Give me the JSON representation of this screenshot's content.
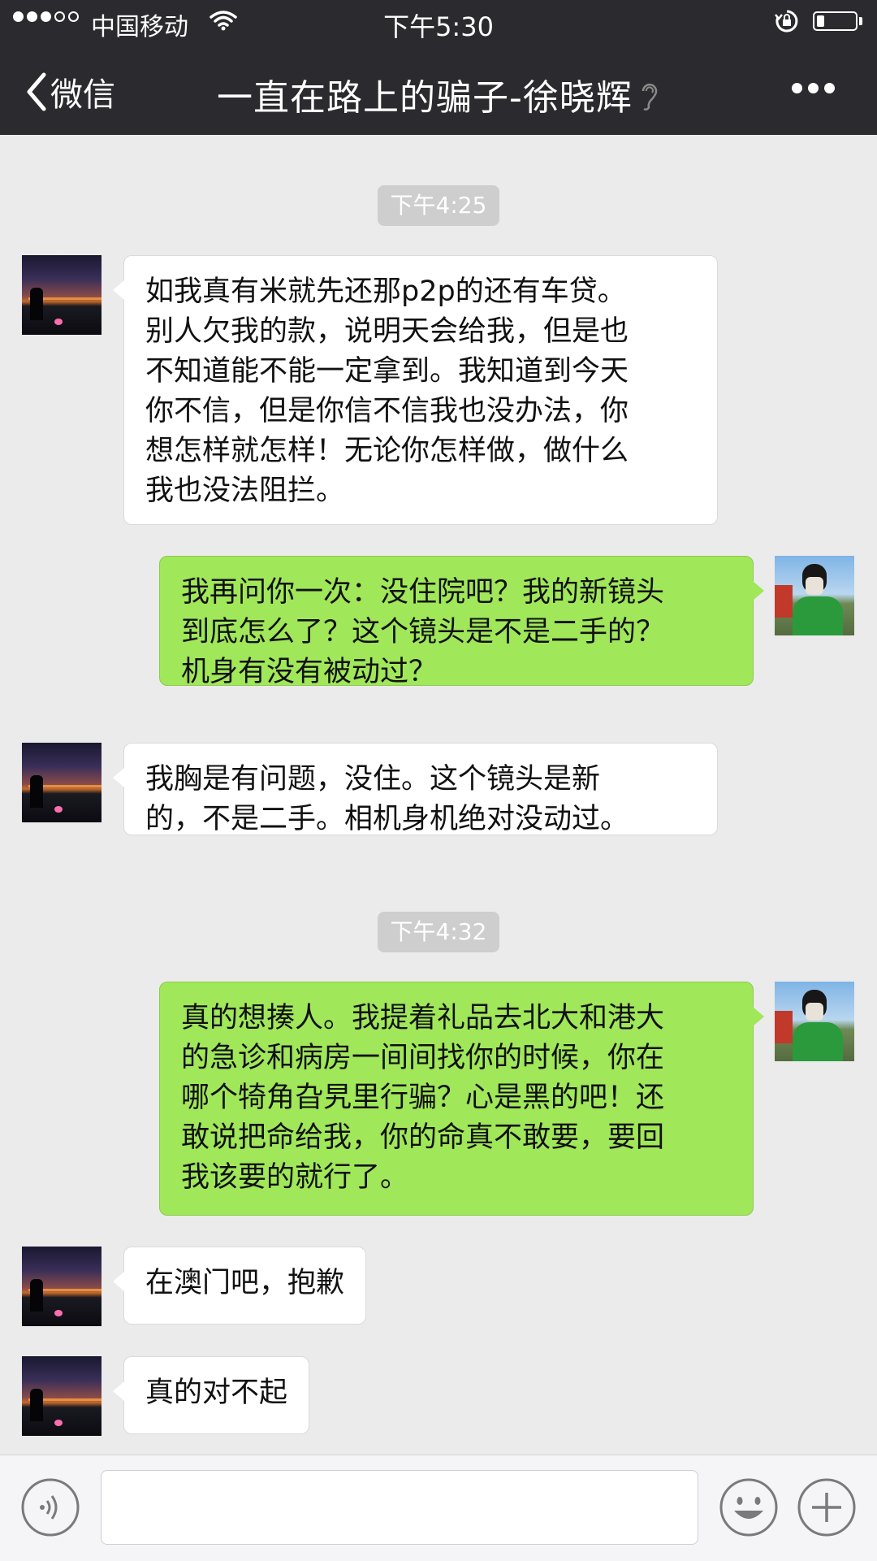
{
  "status_bar": {
    "carrier": "中国移动",
    "time": "下午5:30",
    "signal_bars_filled": 3,
    "signal_bars_total": 5,
    "battery_level": 0.2
  },
  "nav": {
    "back_label": "微信",
    "title": "一直在路上的骗子-徐晓辉",
    "icons": [
      "back-chevron-icon",
      "ear-icon",
      "more-icon"
    ]
  },
  "chat": {
    "timestamps": [
      "下午4:25",
      "下午4:32"
    ],
    "messages": [
      {
        "from": "contact",
        "text": "如我真有米就先还那p2p的还有车贷。\n别人欠我的款，说明天会给我，但是也\n不知道能不能一定拿到。我知道到今天\n你不信，但是你信不信我也没办法，你\n想怎样就怎样！无论你怎样做，做什么\n我也没法阻拦。"
      },
      {
        "from": "me",
        "text": "我再问你一次：没住院吧？我的新镜头\n到底怎么了？这个镜头是不是二手的？\n机身有没有被动过？"
      },
      {
        "from": "contact",
        "text": "我胸是有问题，没住。这个镜头是新\n的，不是二手。相机身机绝对没动过。"
      },
      {
        "from": "me",
        "text": "真的想揍人。我提着礼品去北大和港大\n的急诊和病房一间间找你的时候，你在\n哪个犄角旮旯里行骗？心是黑的吧！还\n敢说把命给我，你的命真不敢要，要回\n我该要的就行了。"
      },
      {
        "from": "contact",
        "text": "在澳门吧，抱歉"
      },
      {
        "from": "contact",
        "text": "真的对不起"
      }
    ]
  },
  "input_bar": {
    "value": "",
    "icons": [
      "voice-icon",
      "emoji-icon",
      "plus-icon"
    ]
  },
  "colors": {
    "header_bg": "#2b2b2f",
    "chat_bg": "#ebebeb",
    "outgoing_bubble": "#a0e75a",
    "incoming_bubble": "#ffffff",
    "timestamp_bg": "#cecece"
  }
}
